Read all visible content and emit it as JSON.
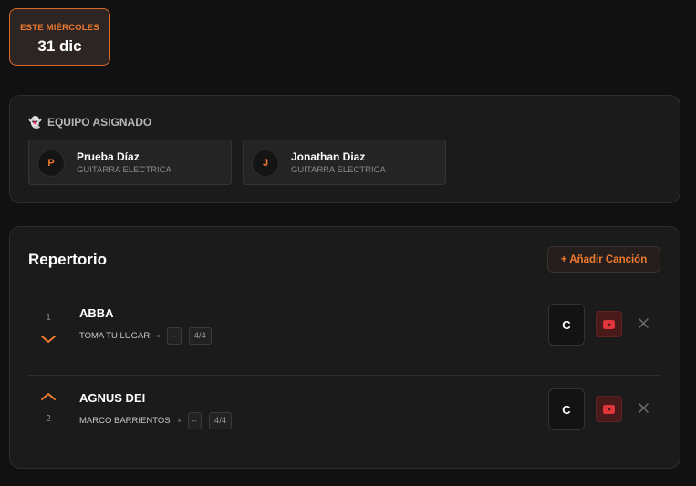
{
  "date_badge": {
    "label": "ESTE MIÉRCOLES",
    "date": "31 dic"
  },
  "team": {
    "title": "EQUIPO ASIGNADO",
    "title_icon": "ghost-emoji",
    "members": [
      {
        "initial": "P",
        "name": "Prueba Díaz",
        "role": "GUITARRA ELECTRICA"
      },
      {
        "initial": "J",
        "name": "Jonathan Diaz",
        "role": "GUITARRA ELECTRICA"
      }
    ]
  },
  "repertoire": {
    "title": "Repertorio",
    "add_label": "+ Añadir Canción",
    "songs": [
      {
        "number": "1",
        "title": "ABBA",
        "artist": "TOMA TU LUGAR",
        "chip_blank": "--",
        "time_signature": "4/4",
        "key": "C"
      },
      {
        "number": "2",
        "title": "AGNUS DEI",
        "artist": "MARCO BARRIENTOS",
        "chip_blank": "--",
        "time_signature": "4/4",
        "key": "C"
      }
    ]
  },
  "colors": {
    "accent": "#f07a2e",
    "youtube": "#e0353a",
    "background": "#111111",
    "panel": "#1b1b1b"
  }
}
